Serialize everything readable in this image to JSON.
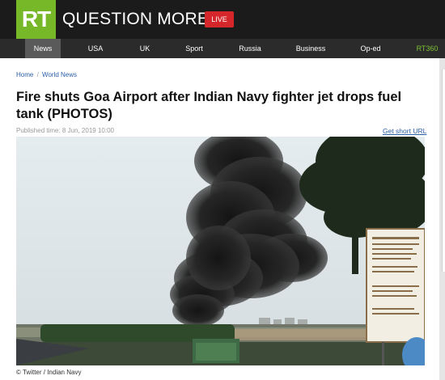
{
  "header": {
    "logo": "RT",
    "tagline": "QUESTION MORE",
    "live_label": "LIVE"
  },
  "nav": {
    "items": [
      {
        "label": "News",
        "active": true
      },
      {
        "label": "USA"
      },
      {
        "label": "UK"
      },
      {
        "label": "Sport"
      },
      {
        "label": "Russia"
      },
      {
        "label": "Business"
      },
      {
        "label": "Op-ed"
      },
      {
        "label": "RT360"
      }
    ]
  },
  "breadcrumb": {
    "home": "Home",
    "separator": "/",
    "section": "World News"
  },
  "article": {
    "title": "Fire shuts Goa Airport after Indian Navy fighter jet drops fuel tank (PHOTOS)",
    "published": "Published time: 8 Jun, 2019 10:00",
    "short_url_label": "Get short URL",
    "photo_caption": "© Twitter / Indian Navy"
  },
  "colors": {
    "brand_green": "#77b829",
    "live_red": "#d4262b",
    "link_blue": "#2a5ea8",
    "header_bg": "#1b1b1b",
    "nav_bg": "#2b2b2b"
  }
}
